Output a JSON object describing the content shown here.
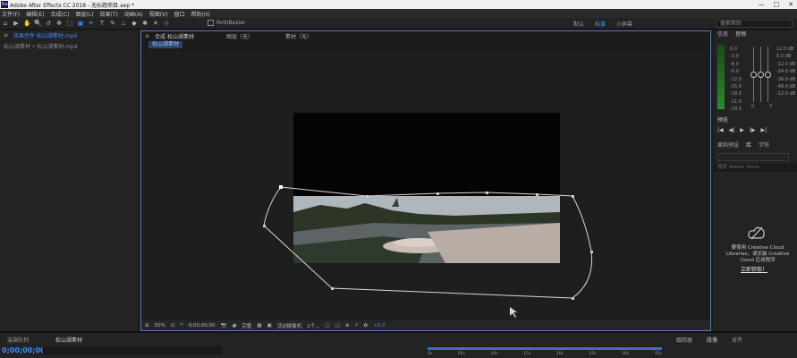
{
  "window": {
    "title": "Adobe After Effects CC 2018 - 无标题项目.aep *",
    "controls": [
      "—",
      "□",
      "✕"
    ]
  },
  "menu": [
    "文件(F)",
    "编辑(E)",
    "合成(C)",
    "图层(L)",
    "效果(T)",
    "动画(A)",
    "视图(V)",
    "窗口",
    "帮助(H)"
  ],
  "toolbar": {
    "tools": [
      "⌂",
      "▶",
      "✋",
      "🔍",
      "↺",
      "✥",
      "⬚",
      "▣",
      "✒",
      "T",
      "✎",
      "⊥",
      "◆",
      "✱",
      "✴",
      "⊹"
    ],
    "roto_label": "RotoBezier",
    "workspaces": [
      "默认",
      "标准",
      "小屏幕"
    ],
    "active_workspace": "标准",
    "search_placeholder": "搜索帮助"
  },
  "project": {
    "tab_effects": "效果控件 松山湖素材.mp4",
    "subtitle": "松山湖素材 • 松山湖素材.mp4"
  },
  "composition": {
    "tab_comp": "合成 松山湖素材",
    "tab_layer": "图层（无）",
    "tab_footage": "素材（无）",
    "crumb": "松山湖素材",
    "footer": {
      "zoom": "50%",
      "time": "0;00;00;00",
      "quality": "完整",
      "camera": "活动摄像机",
      "views": "1个...",
      "exposure": "+0.0"
    }
  },
  "right_panel": {
    "tab_info": "信息",
    "tab_audio": "音频",
    "db_left": [
      "0.0",
      "-3.0",
      "-6.0",
      "-9.0",
      "-12.0",
      "-15.0",
      "-18.0",
      "-21.0",
      "-24.0"
    ],
    "db_right": [
      "12.0 dB",
      "0.0 dB",
      "-12.0 dB",
      "-24.0 dB",
      "-36.0 dB",
      "-48.0 dB",
      "-12.0 dB"
    ],
    "zero_left": "0",
    "zero_right": "0",
    "preview_tab": "预览",
    "transport": [
      "|◀",
      "◀|",
      "▶",
      "|▶",
      "▶|"
    ],
    "lib_tabs": [
      "果和预设",
      "库",
      "字符"
    ],
    "lib_search_placeholder": "搜索 Adobe Stock",
    "cc_message": "要使用 Creative Cloud Libraries，请安装 Creative Cloud 应用程序",
    "cc_link": "立即获取！"
  },
  "timeline": {
    "tab_render": "渲染队列",
    "tab_comp": "松山湖素材",
    "timecode": "0;00;00;00",
    "ruler_ticks": [
      "0s",
      "05s",
      "10s",
      "15s",
      "20s",
      "25s",
      "30s",
      "35s"
    ],
    "tab_align_group": "段落",
    "tab_align": "对齐",
    "tab_tracker": "跟踪器"
  }
}
